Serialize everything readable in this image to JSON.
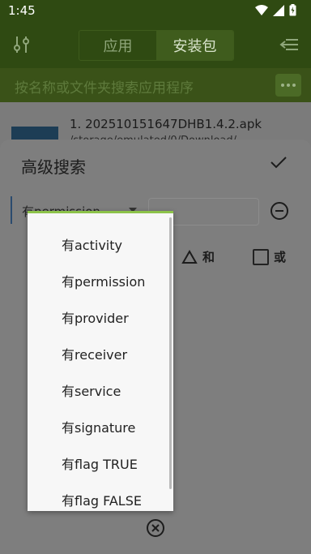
{
  "status_bar": {
    "time": "1:45",
    "icons": [
      "wifi-icon",
      "signal-icon",
      "battery-icon"
    ]
  },
  "toolbar": {
    "filter_icon": "filter-sliders-icon",
    "tabs": [
      {
        "label": "应用"
      },
      {
        "label": "安装包"
      }
    ],
    "active_tab": 1,
    "back_icon": "collapse-left-icon"
  },
  "search": {
    "placeholder": "按名称或文件夹搜索应用程序",
    "more_icon": "more-dots-icon"
  },
  "file_list": [
    {
      "name": "1. 202510151647DHB1.4.2.apk",
      "path": "/storage/emulated/0/Download/..."
    }
  ],
  "dialog": {
    "title": "高级搜索",
    "confirm_icon": "check-icon",
    "condition": {
      "selected": "有permission",
      "value": "",
      "remove_icon": "minus-circle-icon"
    },
    "operators": [
      {
        "label": "和",
        "icon": "triangle-icon"
      },
      {
        "label": "或",
        "icon": "checkbox-icon"
      }
    ],
    "clear_icon": "close-circle-icon"
  },
  "dropdown": {
    "options": [
      "有activity",
      "有permission",
      "有provider",
      "有receiver",
      "有service",
      "有signature",
      "有flag TRUE",
      "有flag FALSE"
    ]
  },
  "colors": {
    "toolbar": "#2f4a12",
    "accent": "#8dc34a",
    "popup_bg": "#f7f7f7"
  }
}
